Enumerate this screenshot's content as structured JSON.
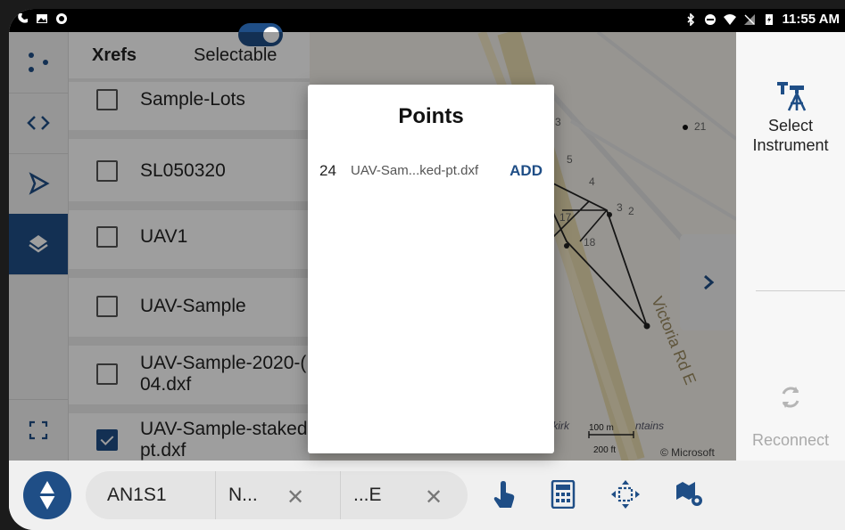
{
  "status_bar": {
    "time": "11:55 AM",
    "icons": [
      "phone-icon",
      "image-icon",
      "record-icon",
      "bluetooth-icon",
      "do-not-disturb-icon",
      "wifi-icon",
      "no-signal-icon",
      "battery-icon"
    ]
  },
  "left_rail": {
    "items": [
      {
        "icon": "dots-icon"
      },
      {
        "icon": "code-brackets-icon"
      },
      {
        "icon": "triangle-arrow-icon"
      },
      {
        "icon": "layers-icon",
        "active": true
      },
      {
        "icon": "fullscreen-icon"
      }
    ]
  },
  "layers_panel": {
    "title": "Xrefs",
    "selectable_label": "Selectable",
    "selectable_on": true,
    "items": [
      {
        "label": "Sample-Lots",
        "checked": false
      },
      {
        "label": "SL050320",
        "checked": false
      },
      {
        "label": "UAV1",
        "checked": false
      },
      {
        "label": "UAV-Sample",
        "checked": false
      },
      {
        "label": "UAV-Sample-2020-(\n04.dxf",
        "checked": false
      },
      {
        "label": "UAV-Sample-staked\npt.dxf",
        "checked": true
      }
    ]
  },
  "map": {
    "road_label": "Victoria Rd E",
    "point_labels": [
      "3",
      "5",
      "4",
      "17",
      "3",
      "2",
      "18",
      "21"
    ],
    "scale_top": "100 m",
    "scale_bottom": "200 ft",
    "place_fragment": "elkirk",
    "place_fragment_2": "ntains",
    "attribution": "© Microsoft"
  },
  "modal": {
    "title": "Points",
    "items": [
      {
        "number": "24",
        "file": "UAV-Sam...ked-pt.dxf",
        "action": "ADD"
      }
    ]
  },
  "right_panel": {
    "instrument_label": "Select\nInstrument",
    "reconnect_label": "Reconnect"
  },
  "bottom_bar": {
    "point_name": "AN1S1",
    "northing": "N...",
    "easting": "...E",
    "tools": [
      "touch-icon",
      "calculator-icon",
      "center-icon",
      "map-settings-icon"
    ]
  },
  "colors": {
    "accent": "#1f4e86",
    "overlay": "rgba(0,0,0,0.38)"
  }
}
